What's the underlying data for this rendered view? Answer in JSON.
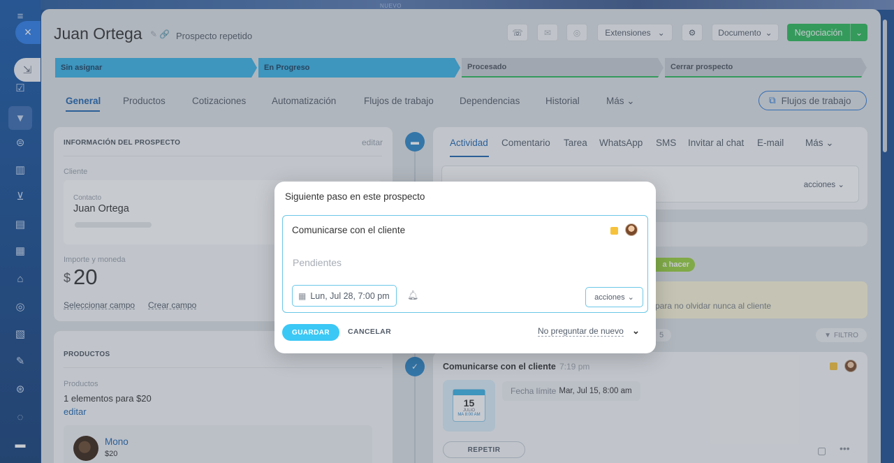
{
  "topbar": {
    "badge": "NUEVO"
  },
  "rail": {
    "close_icon": "×",
    "minimize_icon": "⇲"
  },
  "header": {
    "title": "Juan Ortega",
    "subtitle": "Prospecto repetido",
    "extensions_label": "Extensiones",
    "document_label": "Documento",
    "negotiation_label": "Negociación"
  },
  "stages": [
    {
      "label": "Sin asignar",
      "color": "#3bb4e6"
    },
    {
      "label": "En Progreso",
      "color": "#3bb4e6"
    },
    {
      "label": "Procesado",
      "color": "#c9cdd3"
    },
    {
      "label": "Cerrar prospecto",
      "color": "#c9cdd3"
    }
  ],
  "tabs": [
    "General",
    "Productos",
    "Cotizaciones",
    "Automatización",
    "Flujos de trabajo",
    "Dependencias",
    "Historial",
    "Más"
  ],
  "workflows_button": "Flujos de trabajo",
  "info_card": {
    "header": "INFORMACIÓN DEL PROSPECTO",
    "edit": "editar",
    "client_label": "Cliente",
    "contact_label": "Contacto",
    "contact_name": "Juan Ortega",
    "amount_label": "Importe y moneda",
    "currency": "$",
    "amount": "20",
    "select_field": "Seleccionar campo",
    "create_field": "Crear campo"
  },
  "products_card": {
    "header": "PRODUCTOS",
    "label": "Productos",
    "summary": "1 elementos para $20",
    "edit": "editar",
    "item_name": "Mono",
    "item_price": "$20"
  },
  "activity": {
    "tabs": [
      "Actividad",
      "Comentario",
      "Tarea",
      "WhatsApp",
      "SMS",
      "Invitar al chat",
      "E-mail",
      "Más"
    ],
    "actions": "acciones",
    "todo_badge": "a hacer",
    "reminder_text": "para no olvidar nunca al cliente",
    "filter": "FILTRO",
    "count": "5",
    "entry_title": "Comunicarse con el cliente",
    "entry_time": "7:19 pm",
    "deadline_label": "Fecha límite",
    "deadline_value": "Mar, Jul 15, 8:00 am",
    "cal_day": "15",
    "cal_month": "JULIO",
    "cal_time": "MA 8:00 AM",
    "repeat": "REPETIR"
  },
  "modal": {
    "title": "Siguiente paso en este prospecto",
    "task": "Comunicarse con el cliente",
    "placeholder": "Pendientes",
    "date": "Lun, Jul 28, 7:00 pm",
    "actions": "acciones",
    "save": "GUARDAR",
    "cancel": "CANCELAR",
    "dont_ask": "No preguntar de nuevo"
  }
}
